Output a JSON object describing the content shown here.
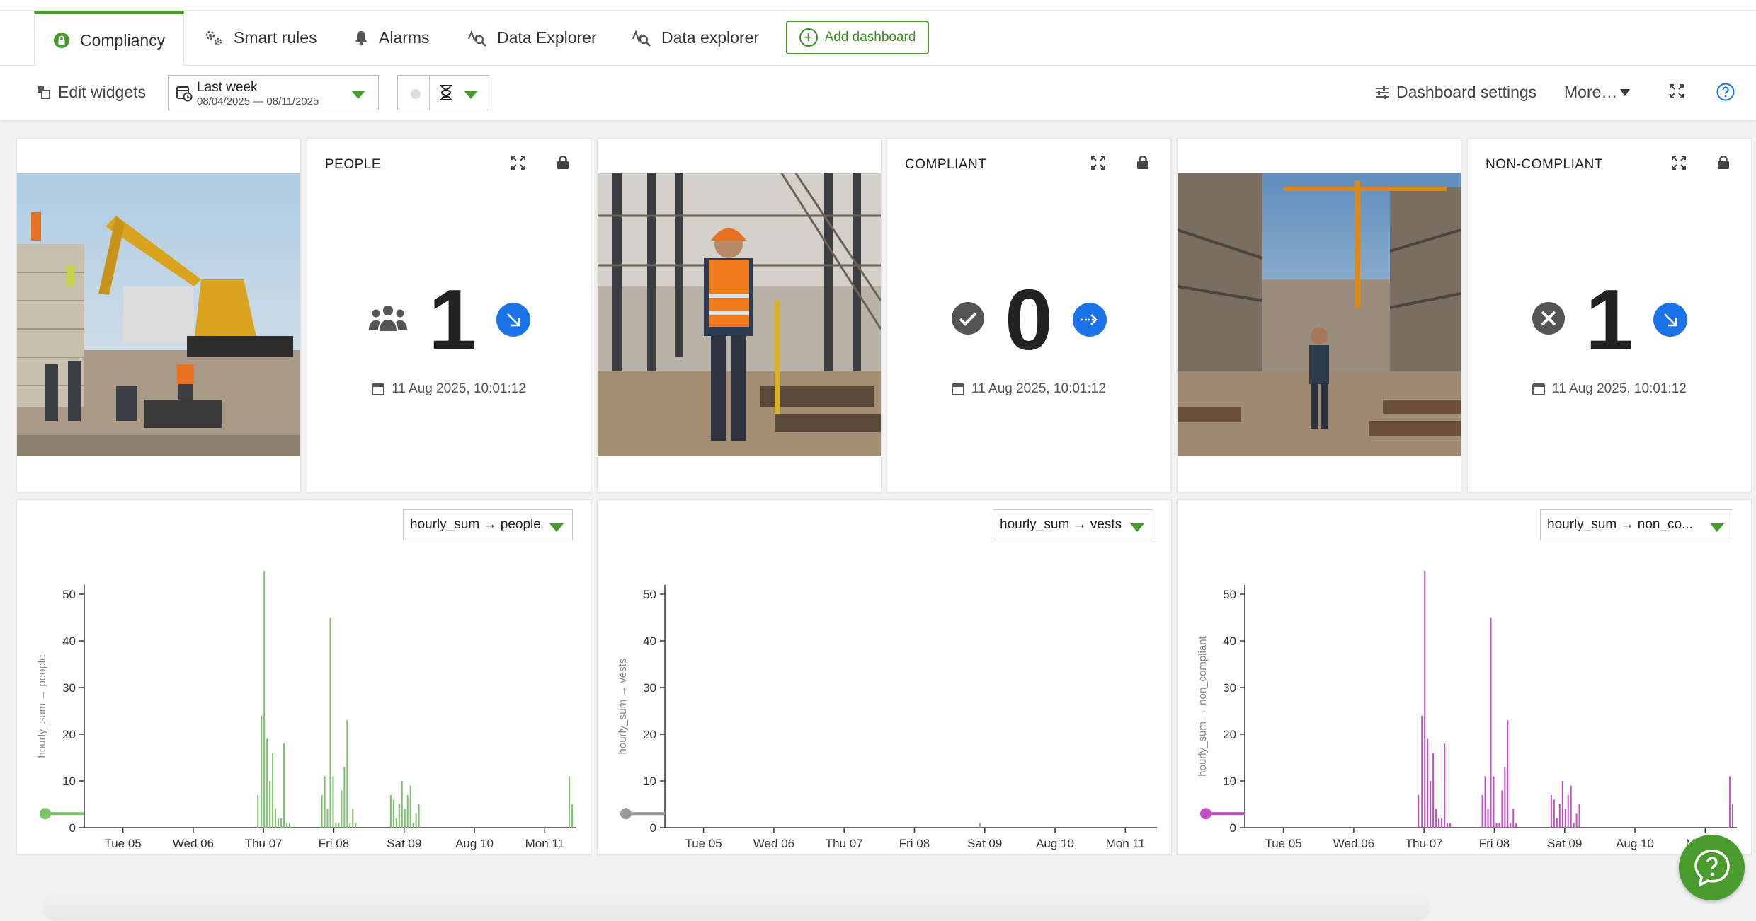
{
  "tabs": [
    {
      "label": "Compliancy",
      "icon": "lock-circle-icon",
      "active": true
    },
    {
      "label": "Smart rules",
      "icon": "gears-icon"
    },
    {
      "label": "Alarms",
      "icon": "bell-icon"
    },
    {
      "label": "Data Explorer",
      "icon": "data-explorer-icon"
    },
    {
      "label": "Data explorer",
      "icon": "data-explorer-icon"
    }
  ],
  "add_dashboard_label": "Add dashboard",
  "toolbar": {
    "edit_widgets": "Edit widgets",
    "range_label": "Last week",
    "range_dates": "08/04/2025 — 08/11/2025",
    "dashboard_settings": "Dashboard settings",
    "more": "More…"
  },
  "widgets": {
    "people": {
      "title": "PEOPLE",
      "value": "1",
      "timestamp": "11 Aug 2025, 10:01:12",
      "icon": "people-icon",
      "trend": "trend-down-icon"
    },
    "compliant": {
      "title": "COMPLIANT",
      "value": "0",
      "timestamp": "11 Aug 2025, 10:01:12",
      "icon": "check-circle-icon",
      "trend": "trend-flat-icon"
    },
    "noncompliant": {
      "title": "NON-COMPLIANT",
      "value": "1",
      "timestamp": "11 Aug 2025, 10:01:12",
      "icon": "x-circle-icon",
      "trend": "trend-down-icon"
    }
  },
  "chart_data": [
    {
      "type": "bar",
      "selector_label": "hourly_sum → people",
      "ylabel": "hourly_sum → people",
      "ylim": [
        0,
        55
      ],
      "yticks": [
        0,
        10,
        20,
        30,
        40,
        50
      ],
      "xticks": [
        "Tue 05",
        "Wed 06",
        "Thu 07",
        "Fri 08",
        "Sat 09",
        "Aug 10",
        "Mon 11"
      ],
      "color": "#7cc26a",
      "marker_value": 3,
      "x": [
        2.47,
        2.52,
        2.56,
        2.6,
        2.64,
        2.68,
        2.72,
        2.76,
        2.8,
        2.84,
        2.88,
        2.92,
        3.38,
        3.42,
        3.46,
        3.5,
        3.54,
        3.58,
        3.62,
        3.66,
        3.7,
        3.74,
        3.78,
        3.82,
        3.86,
        4.36,
        4.4,
        4.44,
        4.48,
        4.52,
        4.56,
        4.6,
        4.64,
        4.68,
        4.72,
        4.76,
        6.9,
        6.94
      ],
      "values": [
        7,
        24,
        55,
        19,
        10,
        16,
        4,
        2,
        2,
        18,
        1,
        1,
        7,
        11,
        4,
        45,
        11,
        1,
        1,
        8,
        13,
        23,
        1,
        4,
        1,
        7,
        6,
        2,
        5,
        10,
        4,
        7,
        9,
        1,
        3,
        5,
        11,
        5
      ]
    },
    {
      "type": "bar",
      "selector_label": "hourly_sum → vests",
      "ylabel": "hourly_sum → vests",
      "ylim": [
        0,
        55
      ],
      "yticks": [
        0,
        10,
        20,
        30,
        40,
        50
      ],
      "xticks": [
        "Tue 05",
        "Wed 06",
        "Thu 07",
        "Fri 08",
        "Sat 09",
        "Aug 10",
        "Mon 11"
      ],
      "color": "#9a9a9a",
      "marker_value": 3,
      "x": [
        4.48
      ],
      "values": [
        1
      ]
    },
    {
      "type": "bar",
      "selector_label": "hourly_sum → non_co...",
      "ylabel": "hourly_sum → non_compliant",
      "ylim": [
        0,
        55
      ],
      "yticks": [
        0,
        10,
        20,
        30,
        40,
        50
      ],
      "xticks": [
        "Tue 05",
        "Wed 06",
        "Thu 07",
        "Fri 08",
        "Sat 09",
        "Aug 10",
        "Mon 11"
      ],
      "color": "#c34fc6",
      "marker_value": 3,
      "x": [
        2.47,
        2.52,
        2.56,
        2.6,
        2.64,
        2.68,
        2.72,
        2.76,
        2.8,
        2.84,
        2.88,
        2.92,
        3.38,
        3.42,
        3.46,
        3.5,
        3.54,
        3.58,
        3.62,
        3.66,
        3.7,
        3.74,
        3.78,
        3.82,
        3.86,
        4.36,
        4.4,
        4.44,
        4.48,
        4.52,
        4.56,
        4.6,
        4.64,
        4.68,
        4.72,
        4.76,
        6.9,
        6.94
      ],
      "values": [
        7,
        24,
        55,
        19,
        10,
        16,
        4,
        2,
        2,
        18,
        1,
        1,
        7,
        11,
        4,
        45,
        11,
        1,
        1,
        8,
        13,
        23,
        1,
        4,
        1,
        7,
        6,
        2,
        5,
        10,
        4,
        7,
        9,
        1,
        3,
        5,
        11,
        5
      ]
    }
  ]
}
